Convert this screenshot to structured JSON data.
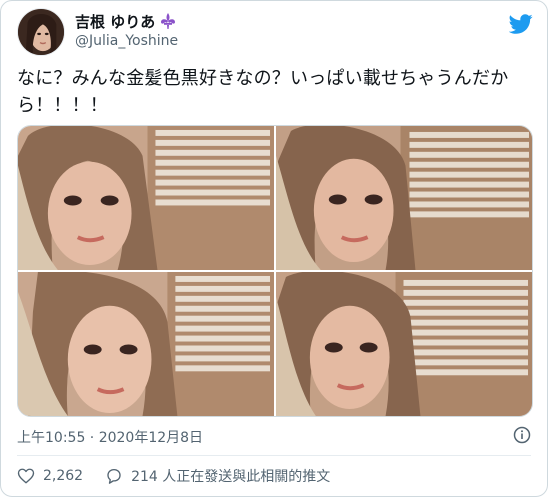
{
  "user": {
    "display_name": "吉根 ゆりあ",
    "handle": "@Julia_Yoshine"
  },
  "tweet": {
    "text": "なに？みんな金髪色黒好きなの？いっぱい載せちゃうんだから！！！！",
    "timestamp": "上午10:55 · 2020年12月8日"
  },
  "actions": {
    "likes": "2,262",
    "replies": "214 人正在發送與此相關的推文"
  },
  "colors": {
    "brand": "#1d9bf0",
    "text": "#0f1419",
    "muted": "#536471",
    "border": "#cfd9de"
  }
}
